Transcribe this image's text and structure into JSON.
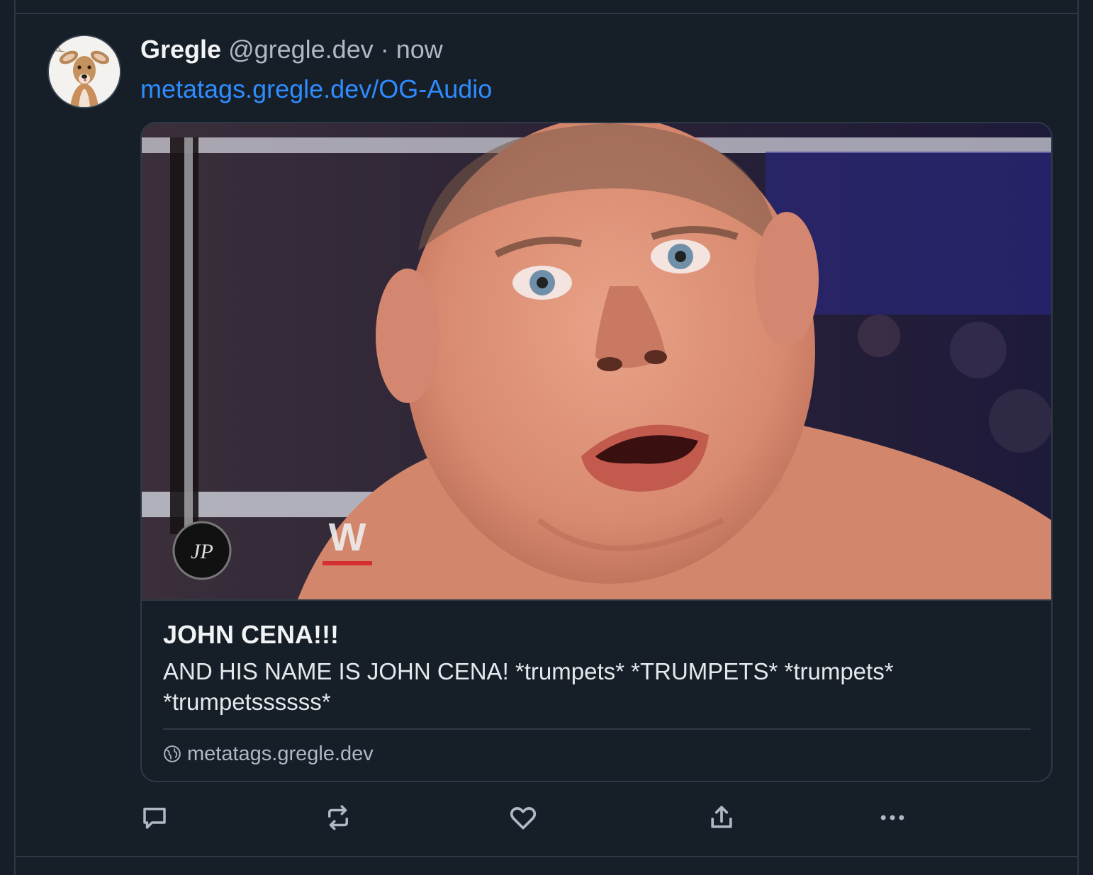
{
  "post": {
    "author_name": "Gregle",
    "author_handle": "@gregle.dev",
    "separator": "·",
    "timestamp": "now",
    "link_text": "metatags.gregle.dev/OG-Audio"
  },
  "link_card": {
    "title": "JOHN CENA!!!",
    "description": "AND HIS NAME IS JOHN CENA! *trumpets* *TRUMPETS* *trumpets* *trumpetssssss*",
    "domain": "metatags.gregle.dev",
    "image_watermark": "W"
  },
  "actions": [
    {
      "icon": "reply-icon"
    },
    {
      "icon": "repost-icon"
    },
    {
      "icon": "like-icon"
    },
    {
      "icon": "share-icon"
    },
    {
      "icon": "more-icon"
    }
  ],
  "colors": {
    "background": "#161e27",
    "border": "#2e3a48",
    "link": "#2f8cff",
    "primary_text": "#f1f3f5",
    "secondary_text": "#aeb9c5"
  }
}
